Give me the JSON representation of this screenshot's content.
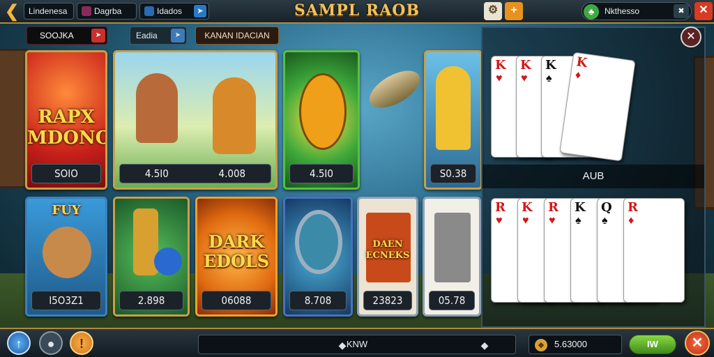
{
  "topbar": {
    "back_icon": "back-arrow-icon",
    "pill1_label": "Lindenesa",
    "pill2_label": "Dagrba",
    "pill3_label": "Idados",
    "title": "SAMPL RAOB",
    "settings_icon": "gear-icon",
    "add_icon": "plus-icon",
    "currency_label": "Nkthesso",
    "close_symbol": "✕"
  },
  "subbar": {
    "tab1_label": "SOOJKA",
    "tab2_label": "Eadia",
    "tab3_label": "KANAN IDACIAN"
  },
  "tiles": [
    {
      "title": "RAPX MDONO",
      "label": "SOIO"
    },
    {
      "label_left": "4.5I0",
      "label_right": "4.008"
    },
    {
      "label": "4.5I0"
    },
    {
      "label": "S0.38"
    },
    {
      "title": "FUY",
      "label": "I5O3Z1"
    },
    {
      "label": "2.898"
    },
    {
      "title": "DARK EDOLS",
      "label": "06088"
    },
    {
      "label": "8.708"
    },
    {
      "title": "DAEN ECNEKS",
      "label": "23823"
    },
    {
      "label": "05.78"
    }
  ],
  "panel": {
    "close_symbol": "✕",
    "mid_label": "AUB",
    "top_cards": [
      {
        "rank": "K",
        "suit": "♥",
        "color": "red"
      },
      {
        "rank": "K",
        "suit": "♥",
        "color": "red"
      },
      {
        "rank": "K",
        "suit": "♠",
        "color": "blk"
      },
      {
        "rank": "K",
        "suit": "♦",
        "color": "red"
      }
    ],
    "bottom_cards": [
      {
        "rank": "R",
        "suit": "♥",
        "color": "red"
      },
      {
        "rank": "K",
        "suit": "♥",
        "color": "red"
      },
      {
        "rank": "R",
        "suit": "♥",
        "color": "red"
      },
      {
        "rank": "K",
        "suit": "♠",
        "color": "blk"
      },
      {
        "rank": "Q",
        "suit": "♠",
        "color": "blk"
      },
      {
        "rank": "R",
        "suit": "♦",
        "color": "red"
      }
    ]
  },
  "bottombar": {
    "center_label": "KNW",
    "balance": "5.63000",
    "go_label": "IW",
    "exit_symbol": "✕"
  }
}
